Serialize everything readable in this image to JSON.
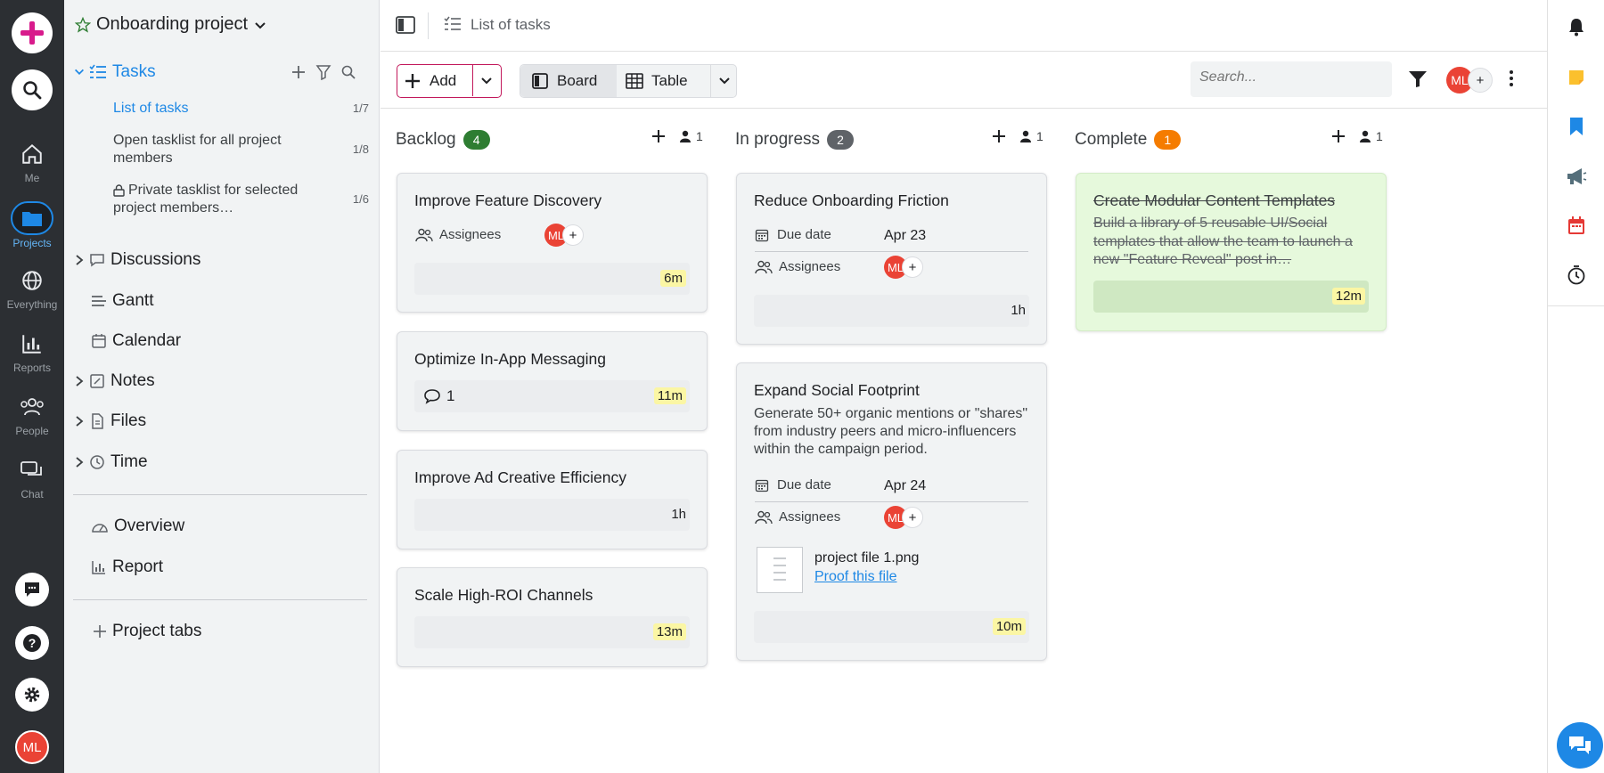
{
  "rail": {
    "items": [
      {
        "label": "Me"
      },
      {
        "label": "Projects"
      },
      {
        "label": "Everything"
      },
      {
        "label": "Reports"
      },
      {
        "label": "People"
      },
      {
        "label": "Chat"
      }
    ],
    "user_initials": "ML"
  },
  "sidebar": {
    "project_title": "Onboarding project",
    "tasks_label": "Tasks",
    "tasklists": [
      {
        "label": "List of tasks",
        "count": "1/7"
      },
      {
        "label": "Open tasklist for all project members",
        "count": "1/8"
      },
      {
        "label": "Private tasklist for selected project members…",
        "count": "1/6"
      }
    ],
    "nav": [
      {
        "label": "Discussions"
      },
      {
        "label": "Gantt"
      },
      {
        "label": "Calendar"
      },
      {
        "label": "Notes"
      },
      {
        "label": "Files"
      },
      {
        "label": "Time"
      }
    ],
    "extra": [
      {
        "label": "Overview"
      },
      {
        "label": "Report"
      }
    ],
    "project_tabs_label": "Project tabs"
  },
  "header": {
    "breadcrumb": "List of tasks"
  },
  "toolbar": {
    "add_label": "Add",
    "board_label": "Board",
    "table_label": "Table",
    "search_placeholder": "Search...",
    "user_initials": "ML"
  },
  "colors": {
    "accent": "#1e88e5",
    "backlog_badge": "#2e7d32",
    "progress_badge": "#5f6368",
    "complete_badge": "#f57c00",
    "avatar": "#ea4335",
    "complete_card": "#e6f9dc"
  },
  "columns": [
    {
      "title": "Backlog",
      "count": "4",
      "members": "1"
    },
    {
      "title": "In progress",
      "count": "2",
      "members": "1"
    },
    {
      "title": "Complete",
      "count": "1",
      "members": "1"
    }
  ],
  "cards": {
    "c1": {
      "title": "Improve Feature Discovery",
      "assignees_label": "Assignees",
      "avatar": "ML",
      "time": "6m"
    },
    "c2": {
      "title": "Optimize In-App Messaging",
      "comments": "1",
      "time": "11m"
    },
    "c3": {
      "title": "Improve Ad Creative Efficiency",
      "time": "1h"
    },
    "c4": {
      "title": "Scale High-ROI Channels",
      "time": "13m"
    },
    "p1": {
      "title": "Reduce Onboarding Friction",
      "due_label": "Due date",
      "due": "Apr 23",
      "assignees_label": "Assignees",
      "avatar": "ML",
      "time": "1h"
    },
    "p2": {
      "title": "Expand Social Footprint",
      "desc": "Generate 50+ organic mentions or \"shares\" from industry peers and micro-influencers within the campaign period.",
      "due_label": "Due date",
      "due": "Apr 24",
      "assignees_label": "Assignees",
      "avatar": "ML",
      "file_name": "project file 1.png",
      "file_action": "Proof this file",
      "time": "10m"
    },
    "d1": {
      "title": "Create Modular Content Templates",
      "desc": "Build a library of 5 reusable UI/Social templates that allow the team to launch a new \"Feature Reveal\" post in…",
      "time": "12m"
    }
  }
}
